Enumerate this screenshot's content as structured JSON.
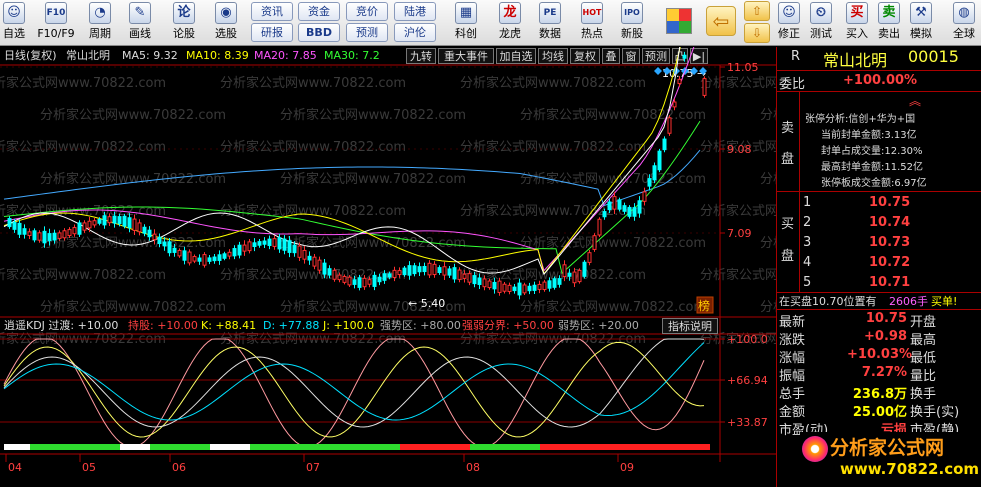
{
  "toolbar": {
    "buttons": [
      {
        "label": "自选",
        "icon": "person-icon",
        "glyph": "☺"
      },
      {
        "label": "F10/F9",
        "icon": "info-icon",
        "glyph": "F10"
      },
      {
        "label": "周期",
        "icon": "period-icon",
        "glyph": "◔"
      },
      {
        "label": "画线",
        "icon": "pen-icon",
        "glyph": "✎"
      },
      {
        "label": "论股",
        "icon": "discuss-icon",
        "glyph": "论"
      },
      {
        "label": "选股",
        "icon": "select-icon",
        "glyph": "◉"
      }
    ],
    "small_buttons": [
      "资讯",
      "资金",
      "竞价",
      "陆港",
      "研报",
      "BBD",
      "预测",
      "沪伦"
    ],
    "buttons2": [
      {
        "label": "科创",
        "icon": "chart-icon",
        "glyph": "▦"
      },
      {
        "label": "龙虎",
        "icon": "dragon-icon",
        "glyph": "龙"
      },
      {
        "label": "数据",
        "icon": "data-icon",
        "glyph": "PE"
      },
      {
        "label": "热点",
        "icon": "hot-icon",
        "glyph": "HOT"
      },
      {
        "label": "新股",
        "icon": "ipo-icon",
        "glyph": "IPO"
      }
    ],
    "buttons3": [
      {
        "label": "修正",
        "icon": "correct-icon",
        "glyph": "☺"
      },
      {
        "label": "测试",
        "icon": "clock-icon",
        "glyph": "⏲"
      },
      {
        "label": "买入",
        "icon": "buy-icon",
        "glyph": "买"
      },
      {
        "label": "卖出",
        "icon": "sell-icon",
        "glyph": "卖"
      },
      {
        "label": "模拟",
        "icon": "sim-icon",
        "glyph": "⚒"
      },
      {
        "label": "全球",
        "icon": "globe-icon",
        "glyph": "◍"
      }
    ]
  },
  "chart_header": {
    "period": "日线(复权)",
    "stock": "常山北明",
    "ma5": "MA5: 9.32",
    "ma10": "MA10: 8.39",
    "ma20": "MA20: 7.85",
    "ma30": "MA30: 7.2",
    "buttons": [
      "九转",
      "重大事件",
      "加自选",
      "均线",
      "复权",
      "叠",
      "窗",
      "预测",
      "凸",
      "▶|"
    ]
  },
  "watermark": "分析家公式网www.70822.com",
  "main_chart": {
    "y_labels": [
      "11.05",
      "9.08",
      "7.09"
    ],
    "high_label": "10.75",
    "low_label": "5.40",
    "badge": "榜"
  },
  "kdj_header": {
    "name": "逍遥KDJ 过渡: +10.00",
    "chicao": "持股: +10.00",
    "k": "K: +88.41",
    "d": "D: +77.88",
    "j": "J: +100.0",
    "strong": "强势区: +80.00",
    "boundary": "强弱分界: +50.00",
    "weak": "弱势区: +20.00",
    "explain_button": "指标说明"
  },
  "kdj_chart": {
    "y_labels": [
      "+100.0",
      "+66.94",
      "+33.87"
    ]
  },
  "x_axis": {
    "labels": [
      "04",
      "05",
      "06",
      "07",
      "08",
      "09"
    ]
  },
  "quote": {
    "r_label": "R",
    "name": "常山北明",
    "code": "00015",
    "weibi_label": "委比",
    "weibi": "+100.00%",
    "sell_label1": "卖",
    "sell_label2": "盘",
    "limit_lines": [
      "张停分析:信创+华为+国",
      "当前封单金额:3.13亿",
      "封单占成交量:12.30%",
      "最高封单金额:11.52亿",
      "张停板成交金额:6.97亿"
    ],
    "buy_label1": "买",
    "buy_label2": "盘",
    "bids": [
      {
        "level": "1",
        "price": "10.75"
      },
      {
        "level": "2",
        "price": "10.74"
      },
      {
        "level": "3",
        "price": "10.73"
      },
      {
        "level": "4",
        "price": "10.72"
      },
      {
        "level": "5",
        "price": "10.71"
      }
    ],
    "buy_pos_text": "在买盘10.70位置有",
    "buy_pos_qty": "2606手",
    "buy_pos_action": "买单!",
    "stats": [
      {
        "label": "最新",
        "value": "10.75",
        "label2": "开盘"
      },
      {
        "label": "涨跌",
        "value": "+0.98",
        "label2": "最高"
      },
      {
        "label": "涨幅",
        "value": "+10.03%",
        "label2": "最低"
      },
      {
        "label": "振幅",
        "value": "7.27%",
        "label2": "量比"
      },
      {
        "label": "总手",
        "value": "236.8万",
        "label2": "换手"
      },
      {
        "label": "金额",
        "value": "25.00亿",
        "label2": "换手(实)"
      },
      {
        "label": "市盈(动)",
        "value": "亏损",
        "label2": "市盈(静)"
      }
    ]
  },
  "logo": {
    "text": "分析家公式网",
    "url": "www.70822.com"
  },
  "colors": {
    "up": "#ff3030",
    "down": "#00ffff",
    "ma5": "#ffffff",
    "ma10": "#ffff00",
    "ma20": "#ff55ff",
    "ma30": "#33ff33",
    "ma60": "#44aaff",
    "frame": "#aa0000"
  }
}
